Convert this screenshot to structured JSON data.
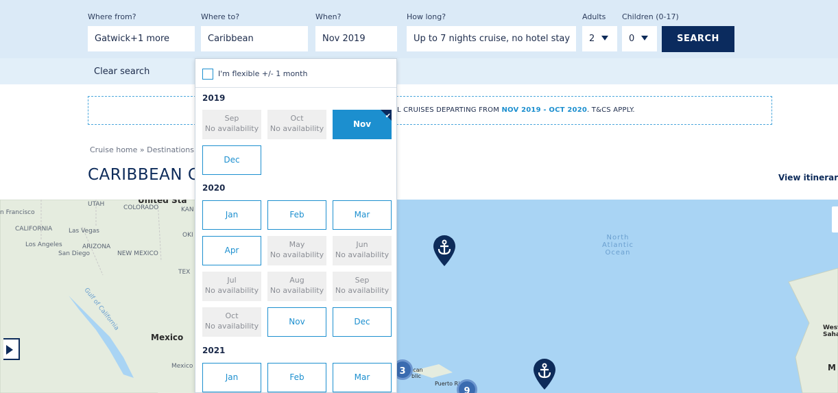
{
  "search": {
    "from_label": "Where from?",
    "from_value": "Gatwick+1 more",
    "to_label": "Where to?",
    "to_value": "Caribbean",
    "when_label": "When?",
    "when_value": "Nov 2019",
    "howlong_label": "How long?",
    "howlong_value": "Up to 7 nights cruise, no hotel stay",
    "adults_label": "Adults",
    "adults_value": "2",
    "children_label": "Children (0-17)",
    "children_value": "0",
    "search_button": "SEARCH",
    "clear_search": "Clear search"
  },
  "promo": {
    "prefix": "L CRUISES DEPARTING FROM ",
    "highlight": "NOV 2019 - OCT 2020",
    "suffix": ". T&CS APPLY."
  },
  "breadcrumb": "Cruise home » Destinations",
  "page_title": "CARIBBEAN C",
  "view_itineraries": "View itineraries",
  "calendar": {
    "flexible_label": "I'm flexible +/- 1 month",
    "unavailable_text": "No availability",
    "years": [
      {
        "year": "2019",
        "months": [
          {
            "name": "Sep",
            "status": "unavailable"
          },
          {
            "name": "Oct",
            "status": "unavailable"
          },
          {
            "name": "Nov",
            "status": "selected"
          },
          {
            "name": "Dec",
            "status": "available"
          }
        ]
      },
      {
        "year": "2020",
        "months": [
          {
            "name": "Jan",
            "status": "available"
          },
          {
            "name": "Feb",
            "status": "available"
          },
          {
            "name": "Mar",
            "status": "available"
          },
          {
            "name": "Apr",
            "status": "available"
          },
          {
            "name": "May",
            "status": "unavailable"
          },
          {
            "name": "Jun",
            "status": "unavailable"
          },
          {
            "name": "Jul",
            "status": "unavailable"
          },
          {
            "name": "Aug",
            "status": "unavailable"
          },
          {
            "name": "Sep",
            "status": "unavailable"
          },
          {
            "name": "Oct",
            "status": "unavailable"
          },
          {
            "name": "Nov",
            "status": "available"
          },
          {
            "name": "Dec",
            "status": "available"
          }
        ]
      },
      {
        "year": "2021",
        "months": [
          {
            "name": "Jan",
            "status": "available"
          },
          {
            "name": "Feb",
            "status": "available"
          },
          {
            "name": "Mar",
            "status": "available"
          }
        ]
      }
    ]
  },
  "map": {
    "labels": {
      "san_francisco": "n Francisco",
      "utah": "UTAH",
      "colorado": "COLORADO",
      "united_states": "United Sta",
      "kan": "KAN",
      "california": "CALIFORNIA",
      "las_vegas": "Las Vegas",
      "los_angeles": "Los Angeles",
      "arizona": "ARIZONA",
      "san_diego": "San Diego",
      "new_mexico": "NEW MEXICO",
      "oki": "OKI",
      "tex": "TEX",
      "gulf_of_california": "Gulf of California",
      "mexico": "Mexico",
      "mexico_city": "Mexico",
      "north_atlantic": "North Atlantic Ocean",
      "western_sahara": "Wester Sahar",
      "m_right": "M",
      "dominican": "ican blic",
      "puerto_rico": "Puerto Ri"
    },
    "clusters": [
      "3",
      "9"
    ],
    "pin_icon": "anchor-icon",
    "colors": {
      "ocean": "#a9d4f4",
      "land": "#e5ecdf",
      "pin": "#0d2b5a"
    }
  },
  "colors": {
    "accent": "#1c8fcf",
    "navy": "#0b2b5e",
    "searchbar_bg": "#dbeaf7"
  }
}
